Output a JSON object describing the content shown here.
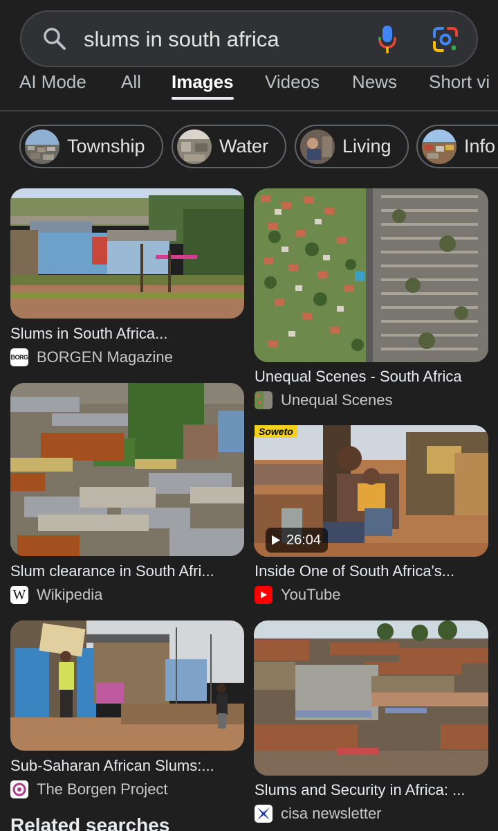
{
  "search": {
    "query": "slums in south africa"
  },
  "tabs": [
    {
      "label": "AI Mode",
      "active": false
    },
    {
      "label": "All",
      "active": false
    },
    {
      "label": "Images",
      "active": true
    },
    {
      "label": "Videos",
      "active": false
    },
    {
      "label": "News",
      "active": false
    },
    {
      "label": "Short vi",
      "active": false
    }
  ],
  "chips": [
    {
      "label": "Township"
    },
    {
      "label": "Water"
    },
    {
      "label": "Living"
    },
    {
      "label": "Info"
    }
  ],
  "results": [
    {
      "title": "Slums in South Africa...",
      "source": "BORGEN Magazine",
      "favicon_text": "BORG"
    },
    {
      "title": "Unequal Scenes - South Africa",
      "source": "Unequal Scenes"
    },
    {
      "title": "Slum clearance in South Afri...",
      "source": "Wikipedia",
      "favicon_text": "W"
    },
    {
      "title": "Inside One of South Africa's...",
      "source": "YouTube",
      "duration": "26:04",
      "image_tag": "Soweto"
    },
    {
      "title": "Sub-Saharan African Slums:...",
      "source": "The Borgen Project"
    },
    {
      "title": "Slums and Security in Africa: ...",
      "source": "cisa newsletter"
    }
  ],
  "related": {
    "heading": "Related searches"
  },
  "colors": {
    "background": "#1f1f1f",
    "search_bar": "#303134",
    "youtube_red": "#ff0000",
    "google_blue": "#4285f4",
    "google_red": "#ea4335",
    "google_yellow": "#fbbc04",
    "google_green": "#34a853"
  }
}
